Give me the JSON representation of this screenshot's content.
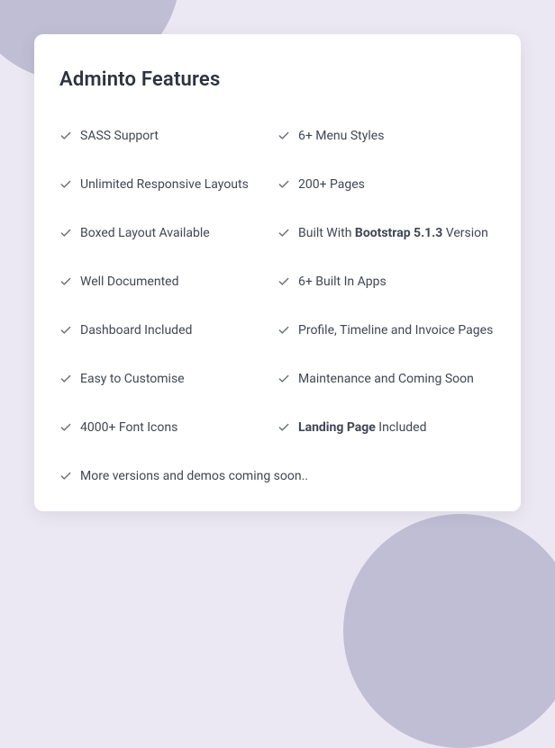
{
  "title": "Adminto Features",
  "features": [
    {
      "html": "SASS Support"
    },
    {
      "html": "6+ Menu Styles"
    },
    {
      "html": "Unlimited Responsive Layouts"
    },
    {
      "html": "200+ Pages"
    },
    {
      "html": "Boxed Layout Available"
    },
    {
      "html": "Built With <strong>Bootstrap 5.1.3</strong> Version"
    },
    {
      "html": "Well Documented"
    },
    {
      "html": "6+ Built In Apps"
    },
    {
      "html": "Dashboard Included"
    },
    {
      "html": "Profile, Timeline and Invoice Pages"
    },
    {
      "html": "Easy to Customise"
    },
    {
      "html": "Maintenance and Coming Soon"
    },
    {
      "html": "4000+ Font Icons"
    },
    {
      "html": "<strong>Landing Page</strong> Included"
    },
    {
      "html": "More versions  and demos coming soon..",
      "full": true
    }
  ]
}
